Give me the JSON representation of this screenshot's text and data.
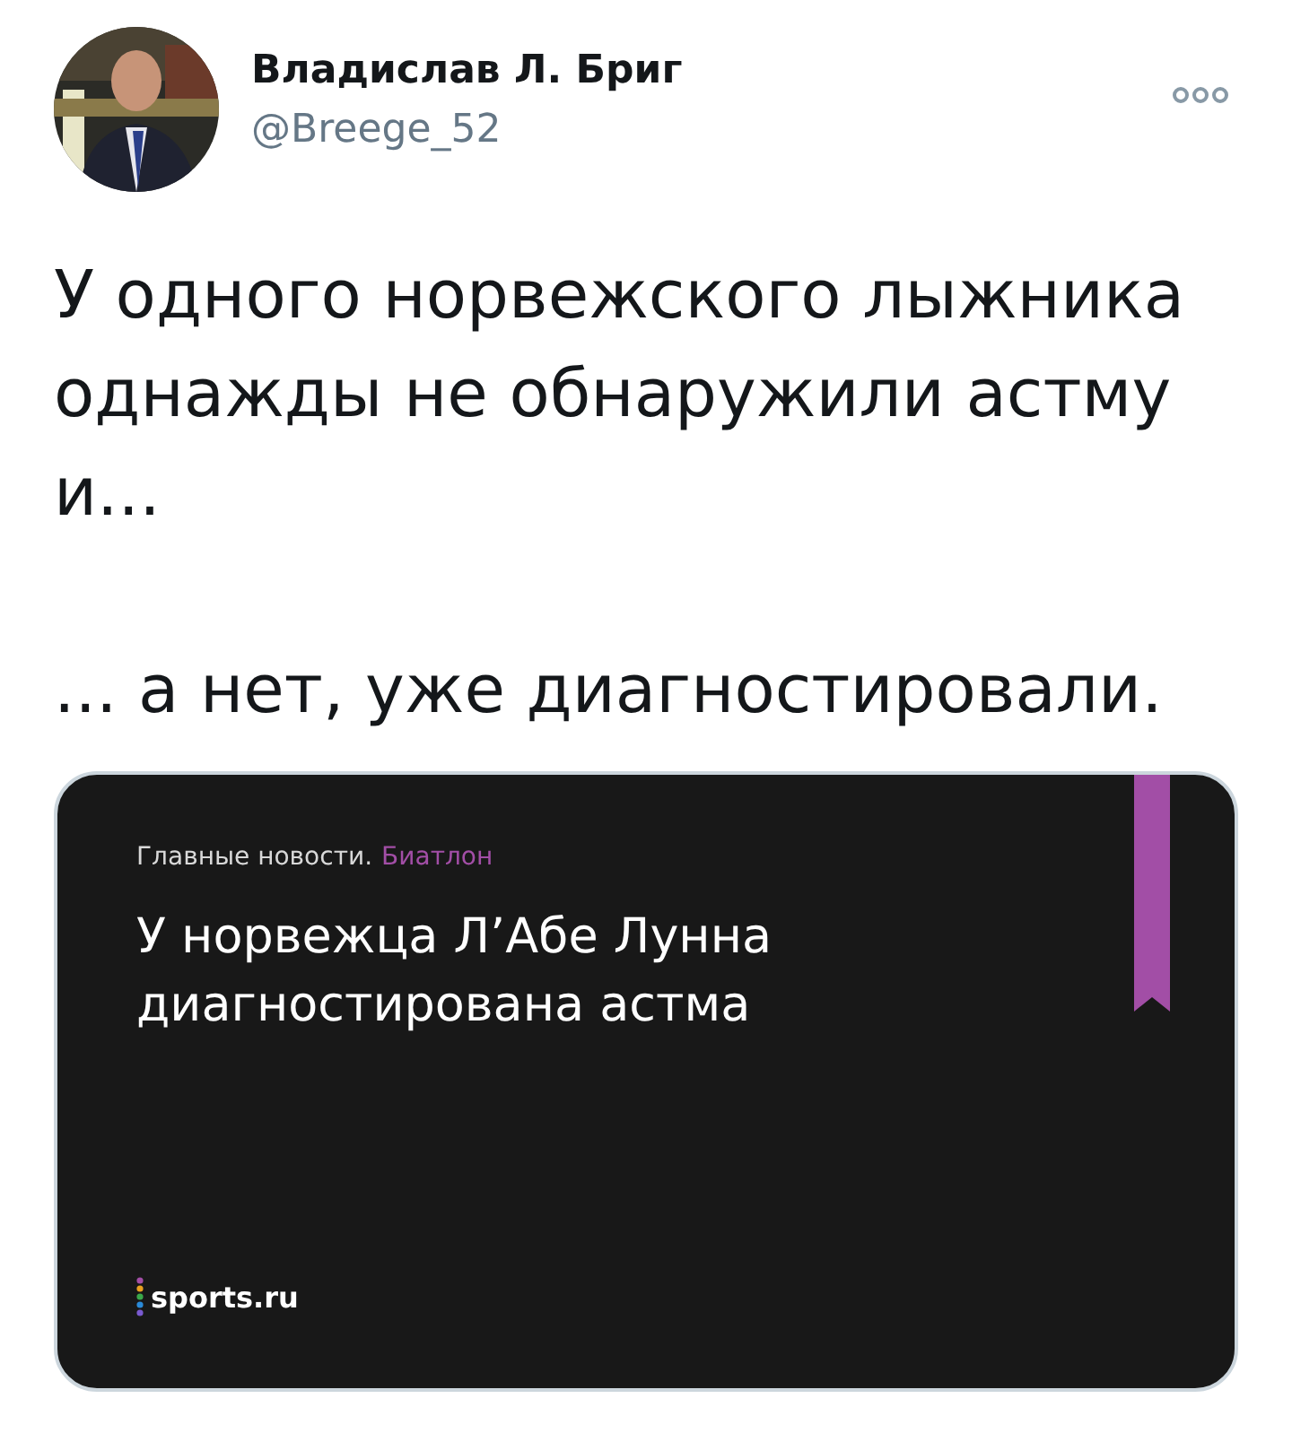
{
  "author": {
    "name": "Владислав Л. Бриг",
    "handle": "@Breege_52"
  },
  "tweet": {
    "paragraphs": [
      "У одного норвежского лыжника однажды не обнаружили астму и...",
      "... а нет, уже диагностировали."
    ]
  },
  "card": {
    "section": "Главные новости.",
    "category": "Биатлон",
    "headline": "У норвежца Л’Абе Лунна диагностирована астма",
    "brand": "sports.ru"
  }
}
